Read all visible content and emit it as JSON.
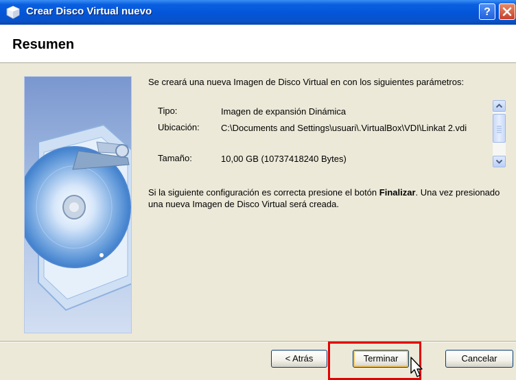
{
  "window": {
    "title": "Crear Disco Virtual nuevo",
    "help_label": "?",
    "title_icon": "virtualbox-icon",
    "close_icon": "close-icon"
  },
  "header": {
    "title": "Resumen"
  },
  "content": {
    "intro": "Se creará una nueva Imagen de Disco Virtual en con los siguientes parámetros:",
    "params": [
      {
        "label": "Tipo:",
        "value": "Imagen de expansión Dinámica"
      },
      {
        "label": "Ubicación:",
        "value": "C:\\Documents and Settings\\usuari\\.VirtualBox\\VDI\\Linkat 2.vdi"
      },
      {
        "label": "Tamaño:",
        "value": "10,00 GB (10737418240 Bytes)"
      }
    ],
    "note_before": "Si la siguiente configuración es correcta presione el botón ",
    "note_bold": "Finalizar",
    "note_after": ". Una vez presionado una nueva Imagen de Disco Virtual será creada."
  },
  "buttons": {
    "back": "< Atrás",
    "finish": "Terminar",
    "cancel": "Cancelar"
  },
  "colors": {
    "titlebar": "#0455d8",
    "highlight": "#e20000",
    "dialog_bg": "#ece9d8"
  }
}
